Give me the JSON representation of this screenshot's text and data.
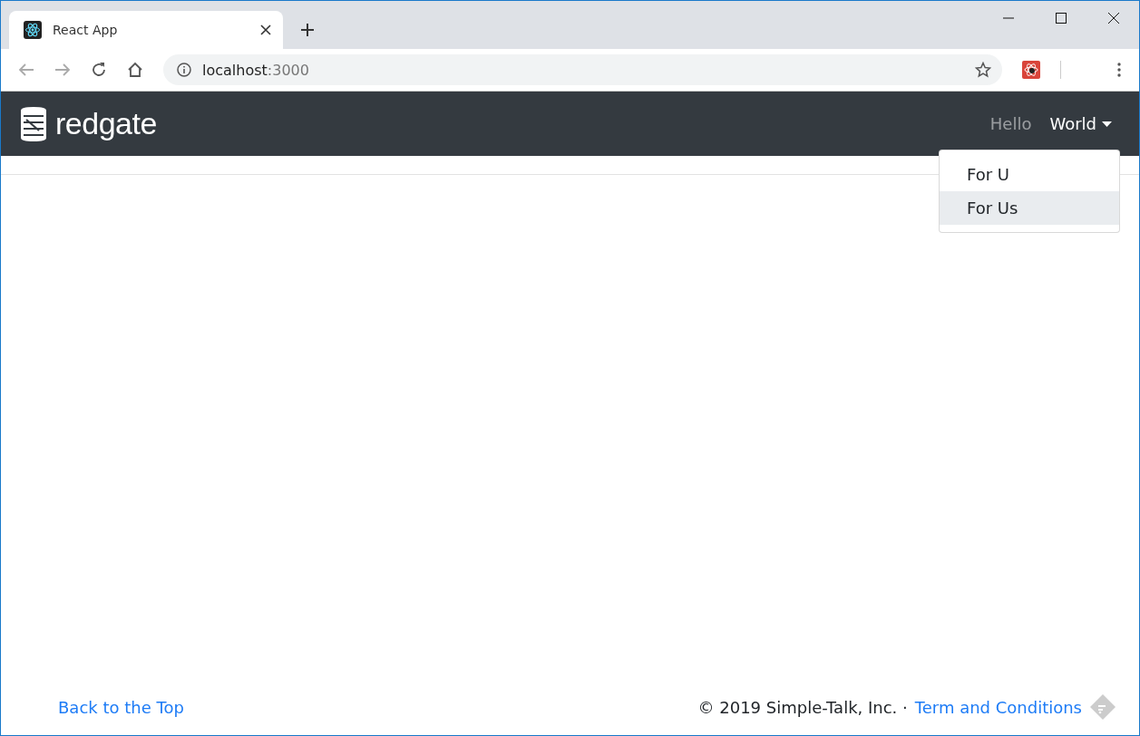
{
  "browser": {
    "tab": {
      "title": "React App",
      "selected": true
    },
    "address": {
      "host": "localhost",
      "port": ":3000"
    }
  },
  "navbar": {
    "brand": "redgate",
    "links": [
      {
        "label": "Hello",
        "selected": false,
        "dropdown": false
      },
      {
        "label": "World",
        "selected": true,
        "dropdown": true
      }
    ],
    "menu": [
      {
        "label": "For U",
        "selected": false
      },
      {
        "label": "For Us",
        "selected": true
      }
    ]
  },
  "footer": {
    "back_link": "Back to the Top",
    "copyright": "© 2019 Simple-Talk, Inc. ·",
    "terms_link": "Term and Conditions"
  }
}
